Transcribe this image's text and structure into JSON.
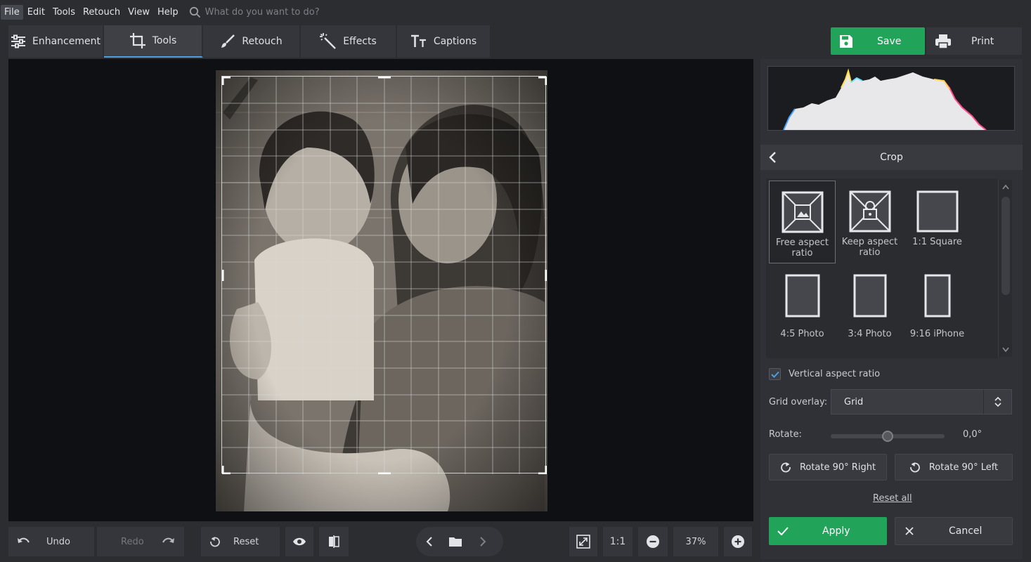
{
  "menu": {
    "items": [
      "File",
      "Edit",
      "Tools",
      "Retouch",
      "View",
      "Help"
    ],
    "search_placeholder": "What do you want to do?"
  },
  "tabs": [
    {
      "label": "Enhancement",
      "icon": "sliders-icon"
    },
    {
      "label": "Tools",
      "icon": "crop-icon"
    },
    {
      "label": "Retouch",
      "icon": "brush-icon"
    },
    {
      "label": "Effects",
      "icon": "magic-wand-icon"
    },
    {
      "label": "Captions",
      "icon": "text-icon"
    }
  ],
  "actions": {
    "save_label": "Save",
    "print_label": "Print"
  },
  "crop": {
    "title": "Crop",
    "presets": [
      {
        "label": "Free aspect ratio",
        "active": true
      },
      {
        "label": "Keep aspect ratio",
        "active": false
      },
      {
        "label": "1:1 Square",
        "active": false
      },
      {
        "label": "4:5 Photo",
        "active": false
      },
      {
        "label": "3:4 Photo",
        "active": false
      },
      {
        "label": "9:16 iPhone",
        "active": false
      }
    ],
    "vertical_aspect_label": "Vertical aspect ratio",
    "vertical_aspect_checked": true,
    "grid_overlay_label": "Grid overlay:",
    "grid_overlay_value": "Grid",
    "rotate_label": "Rotate:",
    "rotate_value": "0,0°",
    "rotate_right_label": "Rotate 90° Right",
    "rotate_left_label": "Rotate 90° Left",
    "reset_all_label": "Reset all",
    "apply_label": "Apply",
    "cancel_label": "Cancel"
  },
  "bottom": {
    "undo_label": "Undo",
    "redo_label": "Redo",
    "reset_label": "Reset",
    "one_to_one_label": "1:1",
    "zoom_value": "37%"
  },
  "colors": {
    "accent_green": "#22a35a",
    "tab_active_underline": "#4d9fe0",
    "canvas_bg": "#0f1014"
  }
}
